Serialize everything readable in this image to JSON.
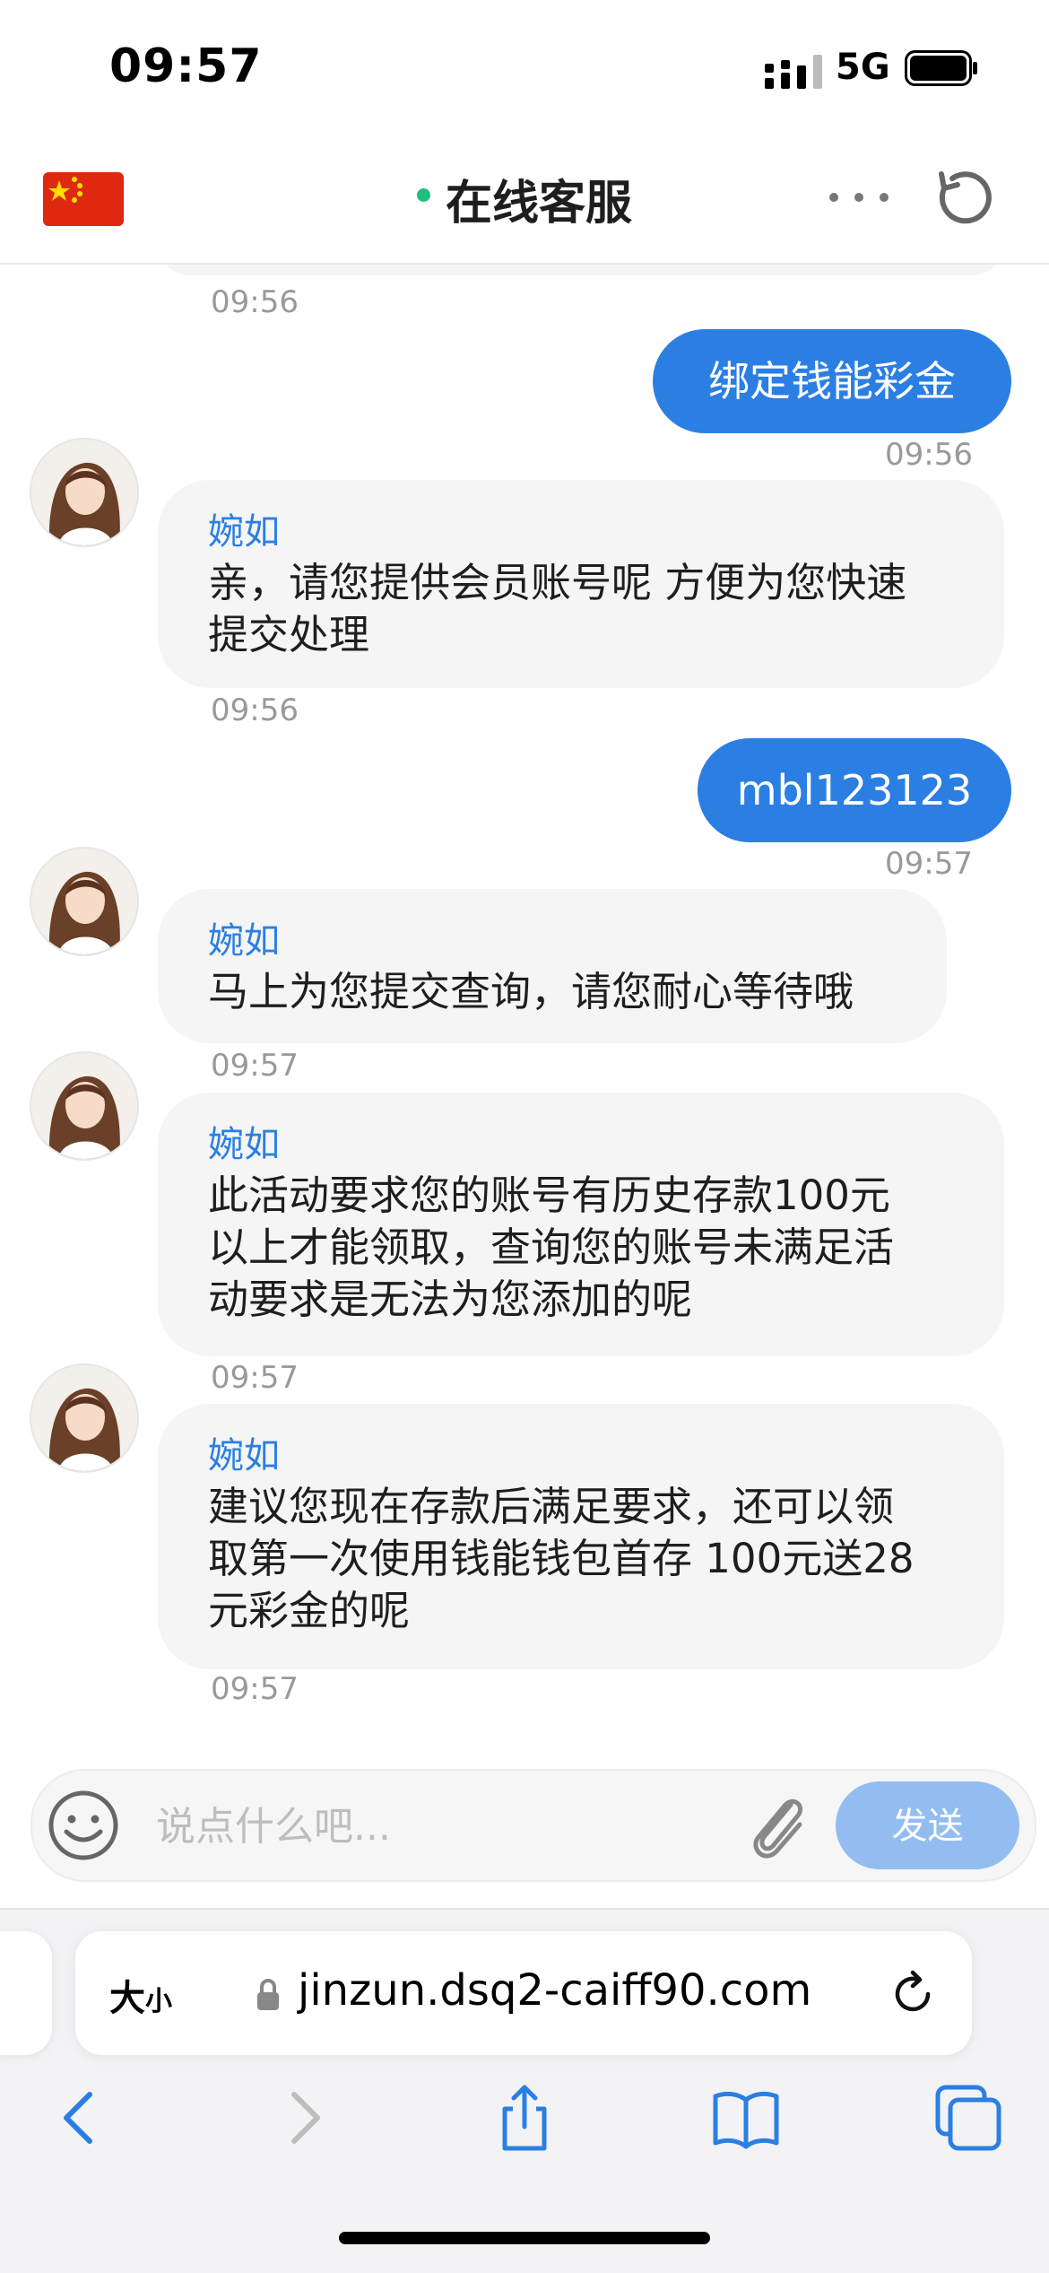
{
  "status_bar": {
    "time": "09:57",
    "network": "5G"
  },
  "header": {
    "title": "在线客服"
  },
  "chat": {
    "messages": [
      {
        "type": "time",
        "side": "left",
        "text": "09:56"
      },
      {
        "type": "user",
        "text": "绑定钱能彩金"
      },
      {
        "type": "time",
        "side": "right",
        "text": "09:56"
      },
      {
        "type": "agent",
        "name": "婉如",
        "lines": [
          "亲，请您提供会员账号呢 方便为您快速",
          "提交处理"
        ]
      },
      {
        "type": "time",
        "side": "left",
        "text": "09:56"
      },
      {
        "type": "user",
        "text": "mbl123123"
      },
      {
        "type": "time",
        "side": "right",
        "text": "09:57"
      },
      {
        "type": "agent",
        "name": "婉如",
        "lines": [
          "马上为您提交查询，请您耐心等待哦"
        ]
      },
      {
        "type": "time",
        "side": "left",
        "text": "09:57"
      },
      {
        "type": "agent",
        "name": "婉如",
        "lines": [
          "此活动要求您的账号有历史存款100元",
          "以上才能领取，查询您的账号未满足活",
          "动要求是无法为您添加的呢"
        ]
      },
      {
        "type": "time",
        "side": "left",
        "text": "09:57"
      },
      {
        "type": "agent",
        "name": "婉如",
        "lines": [
          "建议您现在存款后满足要求，还可以领",
          "取第一次使用钱能钱包首存 100元送28",
          "元彩金的呢"
        ]
      },
      {
        "type": "time",
        "side": "left",
        "text": "09:57"
      }
    ]
  },
  "composer": {
    "placeholder": "说点什么吧...",
    "send_label": "发送"
  },
  "browser": {
    "text_size_big": "大",
    "text_size_small": "小",
    "url": "jinzun.dsq2-caiff90.com"
  },
  "colors": {
    "accent": "#2b7fe3",
    "send_disabled": "#93bdf1",
    "online": "#1ec07a",
    "agent_bubble": "#f5f5f5"
  }
}
